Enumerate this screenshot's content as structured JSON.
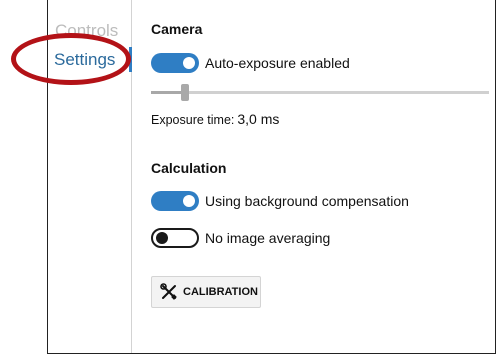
{
  "nav": {
    "items": [
      {
        "label": "Controls"
      },
      {
        "label": "Settings",
        "selected": true
      }
    ]
  },
  "camera": {
    "heading": "Camera",
    "auto_exposure": {
      "label": "Auto-exposure enabled",
      "on": true
    },
    "exposure_slider": {
      "value_fraction": 0.1
    },
    "exposure_label": "Exposure time:",
    "exposure_value": "3,0 ms"
  },
  "calculation": {
    "heading": "Calculation",
    "background_compensation": {
      "label": "Using background compensation",
      "on": true
    },
    "image_averaging": {
      "label": "No image averaging",
      "on": false
    }
  },
  "calibration_button": {
    "label": "CALIBRATION",
    "icon": "tools-icon"
  },
  "colors": {
    "accent": "#2f7ec4",
    "highlight_ring": "#b31217",
    "selected_nav_text": "#2b6a9c"
  }
}
